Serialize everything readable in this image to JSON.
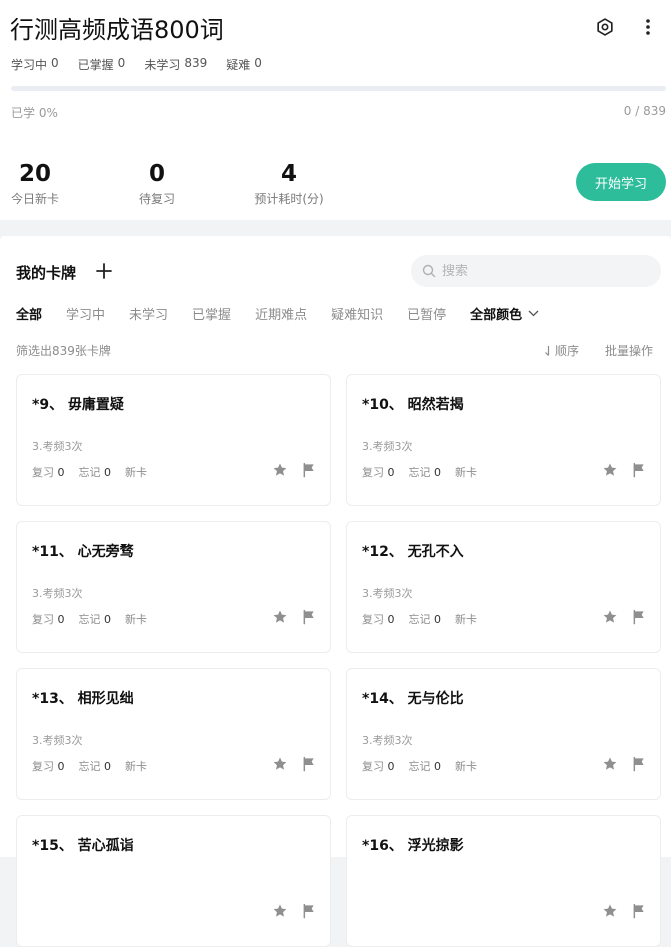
{
  "header": {
    "title": "行测高频成语800词",
    "settings_icon": "gear-icon",
    "more_icon": "more-vertical-icon"
  },
  "status": {
    "learning_label": "学习中",
    "learning_value": "0",
    "mastered_label": "已掌握",
    "mastered_value": "0",
    "unlearned_label": "未学习",
    "unlearned_value": "839",
    "difficult_label": "疑难",
    "difficult_value": "0"
  },
  "progress": {
    "label": "已学 0%",
    "fraction": 0,
    "count": "0 / 839"
  },
  "today": {
    "new_cards_value": "20",
    "new_cards_label": "今日新卡",
    "review_value": "0",
    "review_label": "待复习",
    "time_value": "4",
    "time_label": "预计耗时(分)",
    "start_label": "开始学习"
  },
  "deck": {
    "title": "我的卡牌",
    "search_placeholder": "搜索",
    "tabs": [
      "全部",
      "学习中",
      "未学习",
      "已掌握",
      "近期难点",
      "疑难知识",
      "已暂停"
    ],
    "color_filter": "全部颜色",
    "filter_info": "筛选出839张卡牌",
    "sort_label": "顺序",
    "batch_label": "批量操作"
  },
  "cards": [
    {
      "title": "*9、 毋庸置疑",
      "freq": "3.考频3次",
      "review_label": "复习",
      "review": "0",
      "forget_label": "忘记",
      "forget": "0",
      "status": "新卡"
    },
    {
      "title": "*10、 昭然若揭",
      "freq": "3.考频3次",
      "review_label": "复习",
      "review": "0",
      "forget_label": "忘记",
      "forget": "0",
      "status": "新卡"
    },
    {
      "title": "*11、 心无旁骛",
      "freq": "3.考频3次",
      "review_label": "复习",
      "review": "0",
      "forget_label": "忘记",
      "forget": "0",
      "status": "新卡"
    },
    {
      "title": "*12、 无孔不入",
      "freq": "3.考频3次",
      "review_label": "复习",
      "review": "0",
      "forget_label": "忘记",
      "forget": "0",
      "status": "新卡"
    },
    {
      "title": "*13、 相形见绌",
      "freq": "3.考频3次",
      "review_label": "复习",
      "review": "0",
      "forget_label": "忘记",
      "forget": "0",
      "status": "新卡"
    },
    {
      "title": "*14、 无与伦比",
      "freq": "3.考频3次",
      "review_label": "复习",
      "review": "0",
      "forget_label": "忘记",
      "forget": "0",
      "status": "新卡"
    },
    {
      "title": "*15、 苦心孤诣",
      "freq": "",
      "review_label": "",
      "review": "",
      "forget_label": "",
      "forget": "",
      "status": ""
    },
    {
      "title": "*16、 浮光掠影",
      "freq": "",
      "review_label": "",
      "review": "",
      "forget_label": "",
      "forget": "",
      "status": ""
    }
  ],
  "colors": {
    "accent": "#2dbd9b",
    "progress_track": "#eaeef3",
    "icon_gray": "#8f8f8f"
  }
}
